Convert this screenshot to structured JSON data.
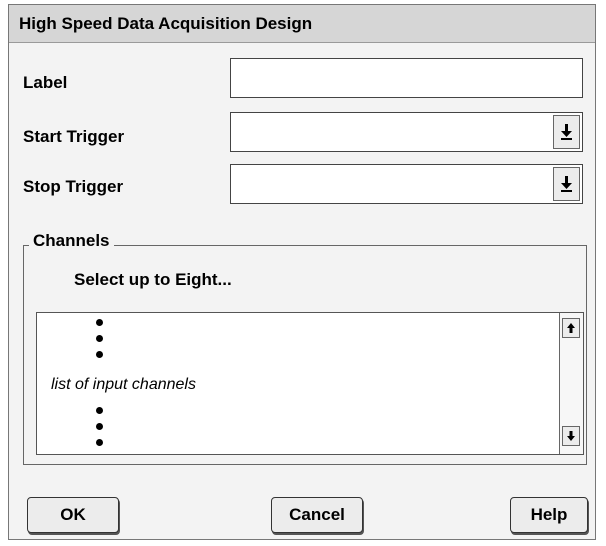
{
  "dialog": {
    "title": "High Speed Data Acquisition Design"
  },
  "fields": {
    "label": {
      "caption": "Label",
      "value": ""
    },
    "start_trigger": {
      "caption": "Start Trigger",
      "value": "",
      "button_icon": "arrow-down-to-bar-icon"
    },
    "stop_trigger": {
      "caption": "Stop Trigger",
      "value": "",
      "button_icon": "arrow-down-to-bar-icon"
    }
  },
  "channels": {
    "group_title": "Channels",
    "instruction": "Select up to Eight...",
    "list_text": "list of input channels",
    "scroll_up_icon": "arrow-up-icon",
    "scroll_down_icon": "arrow-down-icon"
  },
  "buttons": {
    "ok": "OK",
    "cancel": "Cancel",
    "help": "Help"
  }
}
